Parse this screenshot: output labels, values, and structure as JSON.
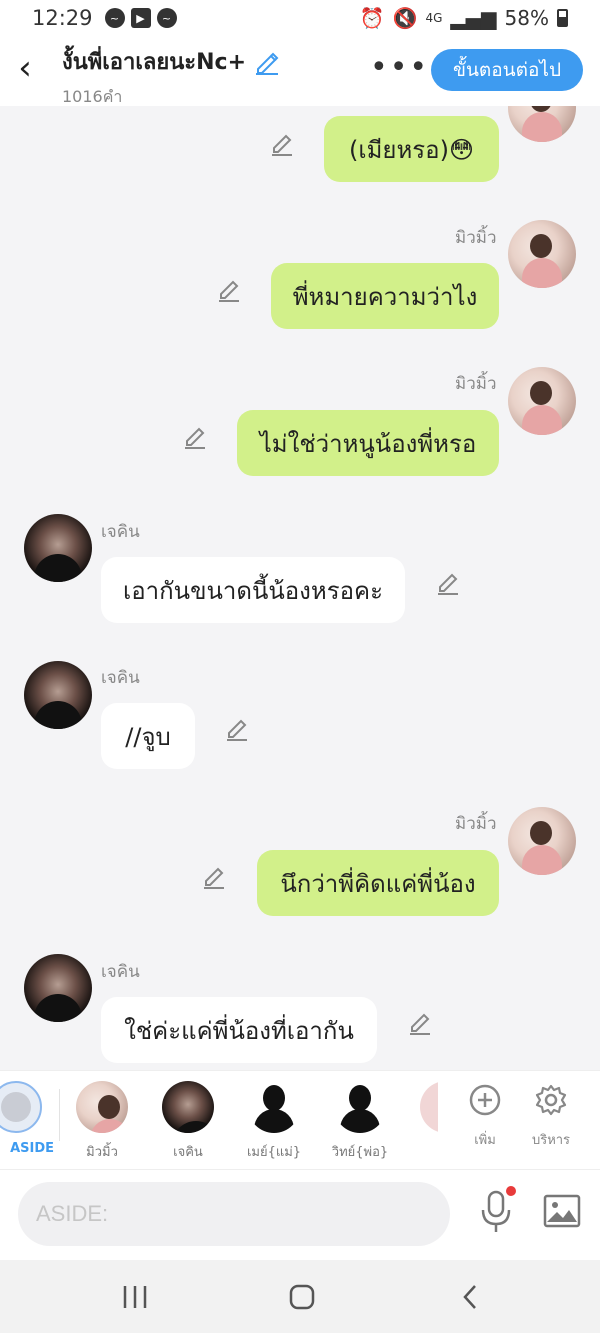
{
  "status": {
    "time": "12:29",
    "network": "4G",
    "battery": "58%"
  },
  "header": {
    "title": "งั้นพี่เอาเลยนะNc+",
    "word_count": "1016คำ",
    "next_button": "ขั้นตอนต่อไป"
  },
  "messages": [
    {
      "side": "right",
      "name": "",
      "text": "(เมียหรอ)😳"
    },
    {
      "side": "right",
      "name": "มิวมิ้ว",
      "text": "พี่หมายความว่าไง"
    },
    {
      "side": "right",
      "name": "มิวมิ้ว",
      "text": "ไม่ใช่ว่าหนูน้องพี่หรอ"
    },
    {
      "side": "left",
      "name": "เจคิน",
      "text": "เอากันขนาดนี้น้องหรอคะ"
    },
    {
      "side": "left",
      "name": "เจคิน",
      "text": "//จูบ"
    },
    {
      "side": "right",
      "name": "มิวมิ้ว",
      "text": "นึกว่าพี่คิดแค่พี่น้อง"
    },
    {
      "side": "left",
      "name": "เจคิน",
      "text": "ใช่ค่ะแค่พี่น้องที่เอากัน"
    }
  ],
  "characters": [
    {
      "label": "ASIDE"
    },
    {
      "label": "มิวมิ้ว"
    },
    {
      "label": "เจคิน"
    },
    {
      "label": "เมย์{แม่}"
    },
    {
      "label": "วิทย์{พ่อ}"
    }
  ],
  "tools": {
    "add": "เพิ่ม",
    "manage": "บริหาร"
  },
  "input": {
    "placeholder": "ASIDE:"
  },
  "colors": {
    "accent": "#3e9bf0",
    "my_bubble": "#d2f08a",
    "their_bubble": "#ffffff"
  }
}
